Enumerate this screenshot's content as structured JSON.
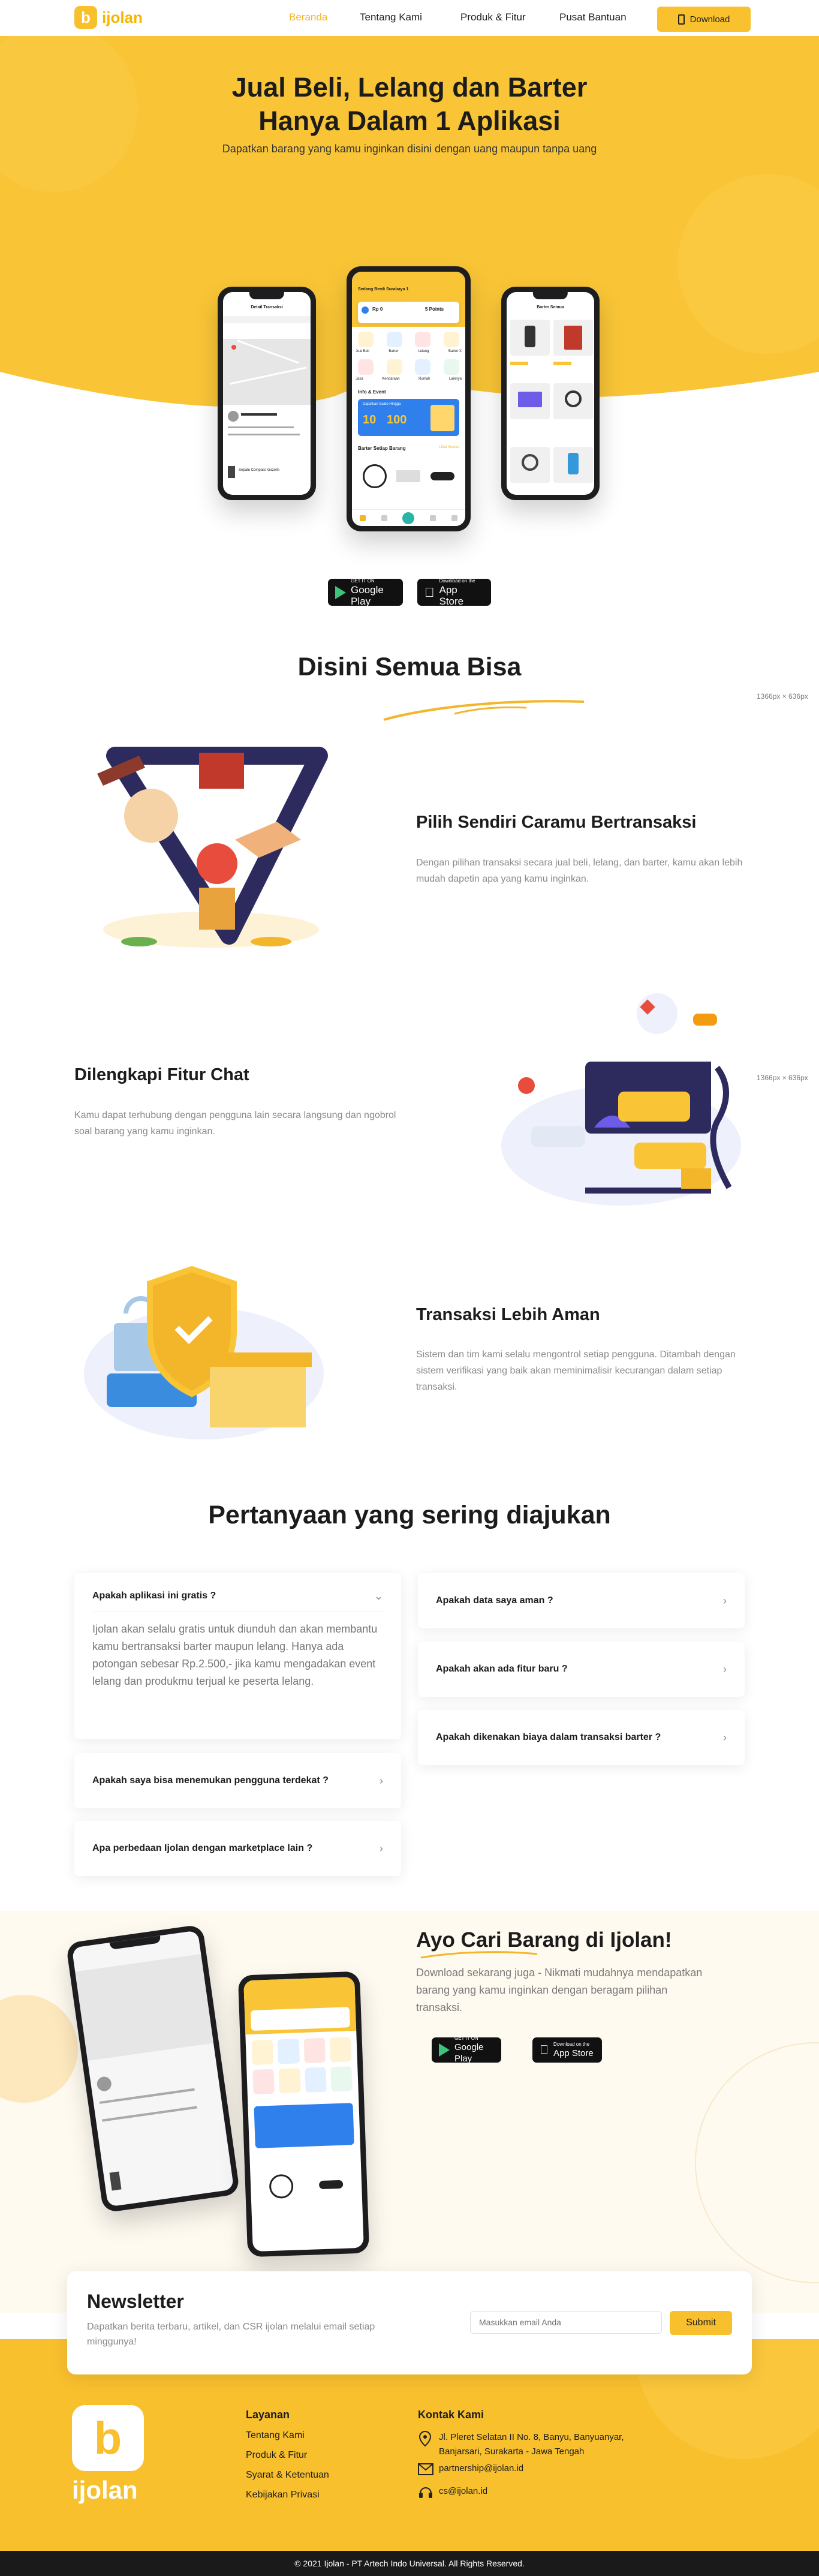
{
  "nav": {
    "brand": "ijolan",
    "items": [
      "Beranda",
      "Tentang Kami",
      "Produk & Fitur",
      "Pusat Bantuan"
    ],
    "download": "Download",
    "accent": "#f9c02e",
    "active": "#f3b52a"
  },
  "hero": {
    "title_1": "Jual Beli, Lelang dan Barter",
    "title_2": "Hanya Dalam 1 Aplikasi",
    "subtitle": "Dapatkan barang yang kamu inginkan disini dengan uang maupun tanpa uang"
  },
  "phones": {
    "left": {
      "header": "Detail Transaksi",
      "item_name": "Sepatu Compass Gazelle"
    },
    "center": {
      "location": "Sedang Berdi Surabaya 1",
      "balance": "Rp 0",
      "points": "5 Points",
      "menu": [
        "Jual Beli",
        "Barter",
        "Lelang",
        "Barter X"
      ],
      "menu2": [
        "Jasa",
        "Kendaraan",
        "Rumah",
        "Lainnya"
      ],
      "info_title": "Info & Event",
      "banner": "Dapatkan Saldo Hingga",
      "banner_a": "10",
      "banner_b": "100",
      "section2": "Barter Setiap Barang",
      "more": "Lihat Semua"
    },
    "right": {
      "header": "Barter Semua"
    }
  },
  "stores": {
    "google_small": "GET IT ON",
    "google_big": "Google Play",
    "apple_small": "Download on the",
    "apple_big": "App Store"
  },
  "features": {
    "section_title": "Disini Semua Bisa",
    "dim_label": "1366px × 636px",
    "items": [
      {
        "title": "Pilih Sendiri Caramu Bertransaksi",
        "text": "Dengan pilihan transaksi secara jual beli, lelang, dan barter, kamu akan lebih mudah dapetin apa yang kamu inginkan."
      },
      {
        "title": "Dilengkapi Fitur Chat",
        "text": "Kamu dapat terhubung dengan pengguna lain secara langsung dan ngobrol soal barang yang kamu inginkan."
      },
      {
        "title": "Transaksi Lebih Aman",
        "text": "Sistem dan tim kami selalu mengontrol setiap pengguna. Ditambah dengan sistem verifikasi yang baik akan meminimalisir kecurangan dalam setiap transaksi."
      }
    ]
  },
  "faq": {
    "title": "Pertanyaan yang sering diajukan",
    "left": [
      {
        "q": "Apakah aplikasi ini gratis ?",
        "a": "Ijolan akan selalu gratis untuk diunduh dan akan membantu kamu bertransaksi barter maupun lelang. Hanya ada potongan sebesar Rp.2.500,- jika kamu mengadakan event lelang dan produkmu terjual ke peserta lelang."
      },
      {
        "q": "Apakah saya bisa menemukan pengguna terdekat ?"
      },
      {
        "q": "Apa perbedaan Ijolan dengan marketplace lain ?"
      }
    ],
    "right": [
      {
        "q": "Apakah data saya aman ?"
      },
      {
        "q": "Apakah akan ada fitur baru ?"
      },
      {
        "q": "Apakah dikenakan biaya dalam transaksi barter ?"
      }
    ]
  },
  "cta": {
    "title": "Ayo Cari Barang di Ijolan!",
    "text": "Download sekarang juga - Nikmati mudahnya mendapatkan barang yang kamu inginkan dengan beragam pilihan transaksi."
  },
  "newsletter": {
    "title": "Newsletter",
    "text": "Dapatkan berita terbaru, artikel, dan CSR ijolan melalui email setiap minggunya!",
    "placeholder": "Masukkan email Anda",
    "button": "Submit"
  },
  "footer": {
    "brand": "ijolan",
    "links_title": "Layanan",
    "links": [
      "Tentang Kami",
      "Produk & Fitur",
      "Syarat & Ketentuan",
      "Kebijakan Privasi"
    ],
    "contact_title": "Kontak Kami",
    "address": "Jl. Pleret Selatan II No. 8, Banyu, Banyuanyar, Banjarsari, Surakarta - Jawa Tengah",
    "email_partner": "partnership@ijolan.id",
    "email_cs": "cs@ijolan.id",
    "copyright": "© 2021 Ijolan - PT Artech Indo Universal. All Rights Reserved."
  }
}
